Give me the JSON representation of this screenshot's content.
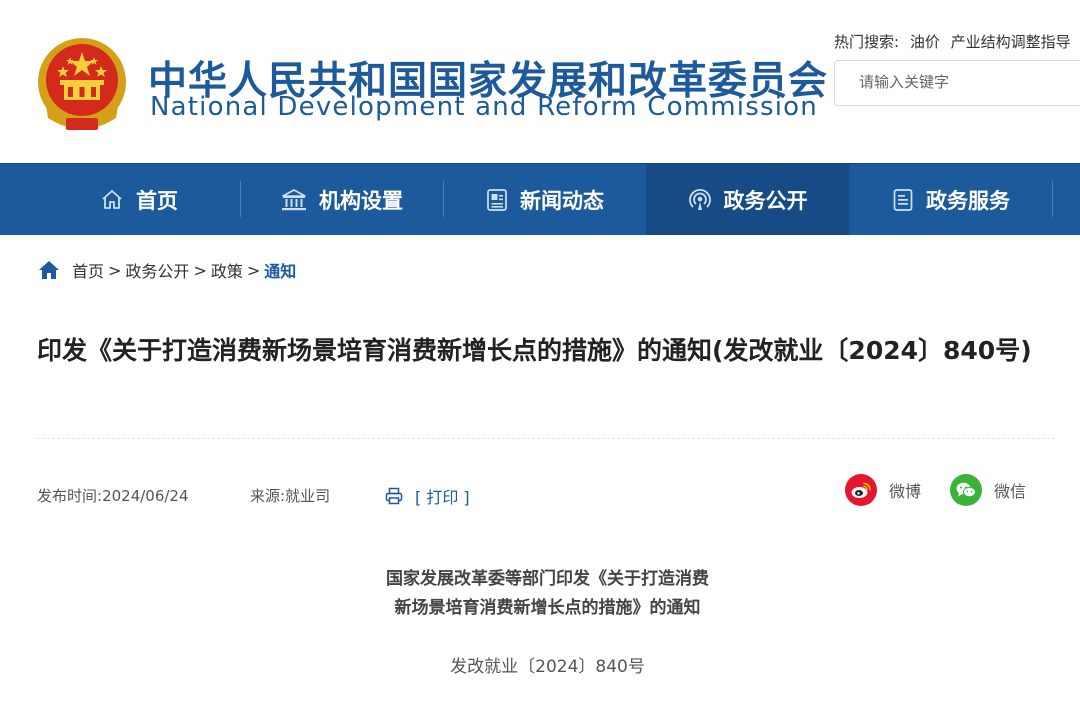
{
  "header": {
    "title_cn": "中华人民共和国国家发展和改革委员会",
    "title_en": "National Development and Reform Commission",
    "hot_label": "热门搜索:",
    "hot_keywords": [
      "油价",
      "产业结构调整指导"
    ],
    "search_placeholder": "请输入关键字"
  },
  "nav": {
    "items": [
      {
        "label": "首页",
        "icon": "home-icon"
      },
      {
        "label": "机构设置",
        "icon": "building-icon"
      },
      {
        "label": "新闻动态",
        "icon": "news-icon"
      },
      {
        "label": "政务公开",
        "icon": "broadcast-icon",
        "active": true
      },
      {
        "label": "政务服务",
        "icon": "document-icon"
      }
    ]
  },
  "breadcrumb": {
    "items": [
      "首页",
      "政务公开",
      "政策"
    ],
    "current": "通知",
    "separator": ">"
  },
  "article": {
    "title": "印发《关于打造消费新场景培育消费新增长点的措施》的通知(发改就业〔2024〕840号)",
    "publish_label": "发布时间:",
    "publish_date": "2024/06/24",
    "source_label": "来源:",
    "source": "就业司",
    "print_label": "[ 打印 ]",
    "share": [
      {
        "label": "微博",
        "icon": "weibo-icon",
        "color": "#e6162d"
      },
      {
        "label": "微信",
        "icon": "wechat-icon",
        "color": "#3bb33b"
      }
    ],
    "subtitle_line1": "国家发展改革委等部门印发《关于打造消费",
    "subtitle_line2": "新场景培育消费新增长点的措施》的通知",
    "doc_number": "发改就业〔2024〕840号"
  },
  "colors": {
    "brand_blue": "#1d5a9c",
    "nav_active": "#174b85"
  }
}
